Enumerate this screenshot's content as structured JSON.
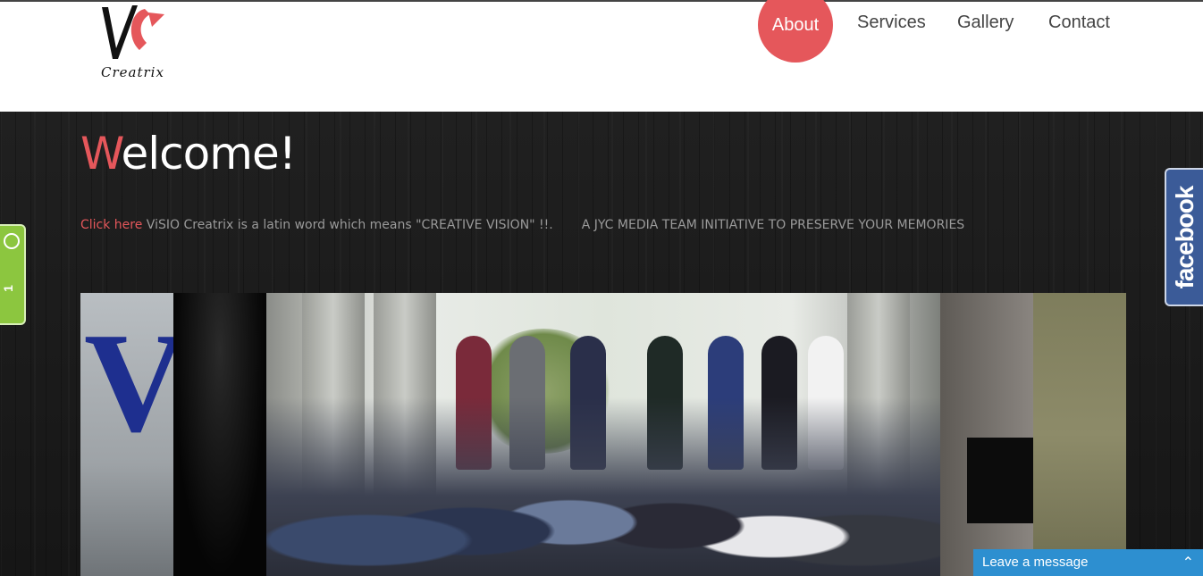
{
  "header": {
    "logo_text": "VISIO Creatrix",
    "nav": [
      {
        "label": "About",
        "active": true
      },
      {
        "label": "Services",
        "active": false
      },
      {
        "label": "Gallery",
        "active": false
      },
      {
        "label": "Contact",
        "active": false
      }
    ]
  },
  "welcome": {
    "first_letter": "W",
    "rest": "elcome!"
  },
  "tagline": {
    "link": "Click here",
    "text": " ViSIO Creatrix is a latin word which means \"CREATIVE VISION\" !!.",
    "initiative": "A JYC MEDIA TEAM INITIATIVE TO PRESERVE YOUR MEMORIES"
  },
  "social": {
    "facebook_label": "facebook"
  },
  "side_widget": {
    "number": "1"
  },
  "chat": {
    "label": "Leave a message"
  },
  "colors": {
    "accent": "#e5575b",
    "facebook": "#3b5b98",
    "chat": "#2d8fd0",
    "widget": "#8cc63f"
  }
}
